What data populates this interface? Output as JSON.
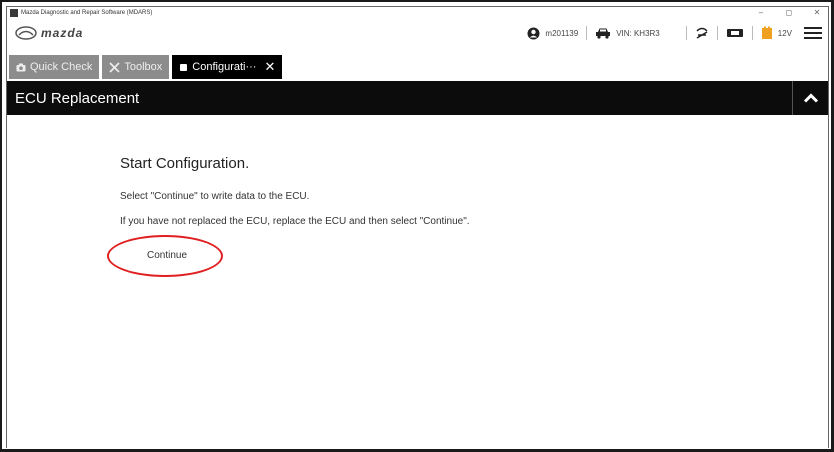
{
  "window": {
    "title": "Mazda Diagnostic and Repair Software (MDARS)",
    "controls": [
      "–",
      "◻",
      "✕"
    ]
  },
  "header": {
    "logo_text": "mazda",
    "user": "m201139",
    "vin": "VIN: KH3R3",
    "battery_voltage": "12V",
    "icons": [
      "user-icon",
      "car-icon",
      "connection-icon",
      "vci-icon",
      "battery-icon",
      "menu-icon"
    ]
  },
  "tabs": [
    {
      "label": "Quick Check",
      "icon": "camera-icon"
    },
    {
      "label": "Toolbox",
      "icon": "wrench-icon"
    },
    {
      "label": "Configurati···",
      "icon": "module-icon",
      "close": "✕",
      "active": true
    }
  ],
  "section": {
    "title": "ECU Replacement"
  },
  "main": {
    "heading": "Start Configuration.",
    "line1": "Select \"Continue\" to write data to the ECU.",
    "line2": "If you have not replaced the ECU, replace the ECU and then select \"Continue\".",
    "continue_label": "Continue"
  },
  "colors": {
    "section_bar": "#0c0c0c",
    "tab_inactive": "#8c8c8c",
    "tab_active": "#000000",
    "highlight": "#e02020"
  }
}
